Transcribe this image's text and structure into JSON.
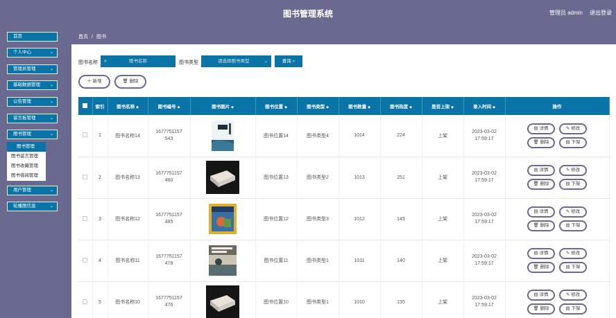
{
  "header": {
    "title": "图书管理系统",
    "admin": "管理员 admin",
    "logout": "退出登录"
  },
  "sidebar": {
    "items": [
      {
        "label": "首页",
        "has_chevron": false
      },
      {
        "label": "个人中心",
        "has_chevron": true
      },
      {
        "label": "管理员管理",
        "has_chevron": true
      },
      {
        "label": "基础数据管理",
        "has_chevron": true
      },
      {
        "label": "公告管理",
        "has_chevron": true
      },
      {
        "label": "留言板管理",
        "has_chevron": true
      },
      {
        "label": "图书管理",
        "has_chevron": true
      },
      {
        "label": "用户管理",
        "has_chevron": true
      },
      {
        "label": "轮播图信息",
        "has_chevron": true
      }
    ],
    "submenu": [
      "图书管理",
      "图书留言管理",
      "图书收藏管理",
      "图书借阅管理"
    ]
  },
  "breadcrumb": {
    "home": "首页",
    "sep": "/",
    "current": "图书"
  },
  "search": {
    "name_label": "图书名称",
    "name_placeholder": "图书名称",
    "type_label": "图书类型",
    "type_placeholder": "请选择图书类型",
    "query_label": "查询"
  },
  "actions": {
    "add": "新增",
    "delete": "删除"
  },
  "table": {
    "headers": [
      "索引",
      "图书名称",
      "图书编号",
      "图书图片",
      "图书位置",
      "图书类型",
      "图书数量",
      "图书热度",
      "是否上架",
      "录入时间",
      "操作"
    ],
    "rows": [
      {
        "index": "1",
        "name": "图书名称14",
        "code": "1677751157543",
        "location": "图书位置14",
        "type": "图书类型4",
        "count": "1014",
        "hot": "224",
        "status": "上架",
        "time": "2023-03-02 17:59:17"
      },
      {
        "index": "2",
        "name": "图书名称13",
        "code": "1677751157460",
        "location": "图书位置13",
        "type": "图书类型2",
        "count": "1013",
        "hot": "251",
        "status": "上架",
        "time": "2023-03-02 17:59:17"
      },
      {
        "index": "3",
        "name": "图书名称12",
        "code": "1677751157485",
        "location": "图书位置12",
        "type": "图书类型3",
        "count": "1012",
        "hot": "145",
        "status": "上架",
        "time": "2023-03-02 17:59:17"
      },
      {
        "index": "4",
        "name": "图书名称11",
        "code": "1677751157478",
        "location": "图书位置11",
        "type": "图书类型1",
        "count": "1011",
        "hot": "140",
        "status": "上架",
        "time": "2023-03-02 17:59:17"
      },
      {
        "index": "5",
        "name": "图书名称10",
        "code": "1677751157476",
        "location": "图书位置10",
        "type": "图书类型1",
        "count": "1010",
        "hot": "135",
        "status": "上架",
        "time": "2023-03-02 17:59:17"
      }
    ],
    "row_actions": {
      "detail": "详情",
      "edit": "修改",
      "delete": "删除",
      "unlist": "下架"
    }
  },
  "colors": {
    "header_bg": "#6a6990",
    "accent": "#0a74a6"
  }
}
